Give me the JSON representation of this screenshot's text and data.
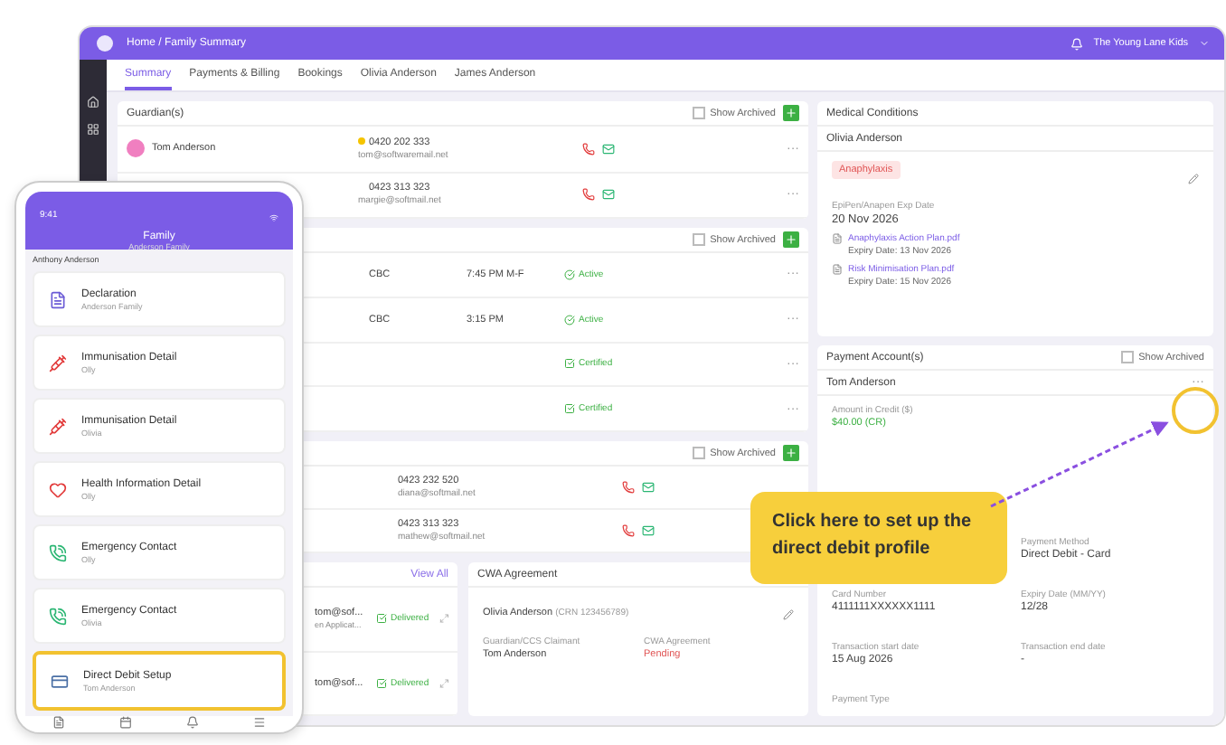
{
  "header": {
    "breadcrumb": "Home / Family Summary",
    "account": "The Young Lane Kids"
  },
  "tabs": [
    {
      "label": "Summary",
      "selected": true
    },
    {
      "label": "Payments & Billing",
      "selected": false
    },
    {
      "label": "Bookings",
      "selected": false
    },
    {
      "label": "Olivia Anderson",
      "selected": false
    },
    {
      "label": "James Anderson",
      "selected": false
    }
  ],
  "guardians": {
    "title": "Guardian(s)",
    "show_archived": {
      "label": "Show Archived",
      "checked": false
    },
    "rows": [
      {
        "name": "Tom Anderson",
        "phone": "0420 202 333",
        "email": "tom@softwaremail.net",
        "primary": true,
        "more": "···"
      },
      {
        "name": "",
        "phone": "0423 313 323",
        "email": "margie@softmail.net",
        "primary": false,
        "more": "···"
      }
    ]
  },
  "children": {
    "show_archived": {
      "label": "Show Archived",
      "checked": false
    },
    "rows": [
      {
        "room": "CBC",
        "time": "7:45 PM M-F",
        "status": "Active",
        "kind": "active",
        "more": "···"
      },
      {
        "room": "CBC",
        "time": "3:15 PM",
        "status": "Active",
        "kind": "active",
        "more": "···"
      },
      {
        "status": "Certified",
        "kind": "certified",
        "more": "···"
      },
      {
        "status": "Certified",
        "kind": "certified",
        "more": "···"
      }
    ]
  },
  "contacts": {
    "show_archived": {
      "label": "Show Archived",
      "checked": false
    },
    "rows": [
      {
        "phone": "0423 232 520",
        "email": "diana@softmail.net"
      },
      {
        "phone": "0423 313 323",
        "email": "mathew@softmail.net"
      }
    ]
  },
  "messages": {
    "link": "View All",
    "rows": [
      {
        "text": "tom@sof...",
        "sub": "en Applicat...",
        "status": "Delivered"
      },
      {
        "text": "tom@sof...",
        "status": "Delivered"
      }
    ]
  },
  "cwa": {
    "title": "CWA Agreement",
    "child": "Olivia Anderson",
    "crn": "(CRN 123456789)",
    "fields": [
      {
        "label": "Guardian/CCS Claimant",
        "value": "Tom Anderson",
        "kind": "plain"
      },
      {
        "label": "CWA Agreement",
        "value": "Pending",
        "kind": "pending"
      }
    ]
  },
  "medical": {
    "title": "Medical Conditions",
    "child": "Olivia Anderson",
    "tag": "Anaphylaxis",
    "date_label": "EpiPen/Anapen Exp Date",
    "date": "20 Nov 2026",
    "documents": [
      {
        "name": "Anaphylaxis Action Plan.pdf",
        "expiry": "Expiry Date: 13 Nov 2026"
      },
      {
        "name": "Risk Minimisation Plan.pdf",
        "expiry": "Expiry Date: 15 Nov 2026"
      }
    ]
  },
  "payments": {
    "title": "Payment Account(s)",
    "show_archived": {
      "label": "Show Archived",
      "checked": false
    },
    "name": "Tom Anderson",
    "more": "···",
    "credit_label": "Amount in Credit ($)",
    "credit": "$40.00 (CR)",
    "fields": [
      {
        "label": "Payment Method",
        "value": "Direct Debit - Card"
      },
      {
        "label": "Card Number",
        "value": "4111111XXXXXX1111"
      },
      {
        "label": "Expiry Date (MM/YY)",
        "value": "12/28"
      },
      {
        "label": "Transaction start date",
        "value": "15 Aug 2026"
      },
      {
        "label": "Transaction end date",
        "value": "-"
      },
      {
        "label": "Payment Type"
      }
    ]
  },
  "phone": {
    "time": "9:41",
    "title": "Family",
    "subtitle": "Anderson Family",
    "section": "Anthony Anderson",
    "items": [
      {
        "title": "Declaration",
        "sub": "Anderson Family",
        "kind": "doc",
        "selected": false
      },
      {
        "title": "Immunisation Detail",
        "sub": "Olly",
        "kind": "immunisation",
        "selected": false
      },
      {
        "title": "Immunisation Detail",
        "sub": "Olivia",
        "kind": "immunisation",
        "selected": false
      },
      {
        "title": "Health Information Detail",
        "sub": "Olly",
        "kind": "health",
        "selected": false
      },
      {
        "title": "Emergency Contact",
        "sub": "Olly",
        "kind": "contact",
        "selected": false
      },
      {
        "title": "Emergency Contact",
        "sub": "Olivia",
        "kind": "contact",
        "selected": false
      },
      {
        "title": "Direct Debit Setup",
        "sub": "Tom Anderson",
        "kind": "payment",
        "selected": true
      }
    ]
  },
  "callout": "Click here to set up the direct debit profile"
}
